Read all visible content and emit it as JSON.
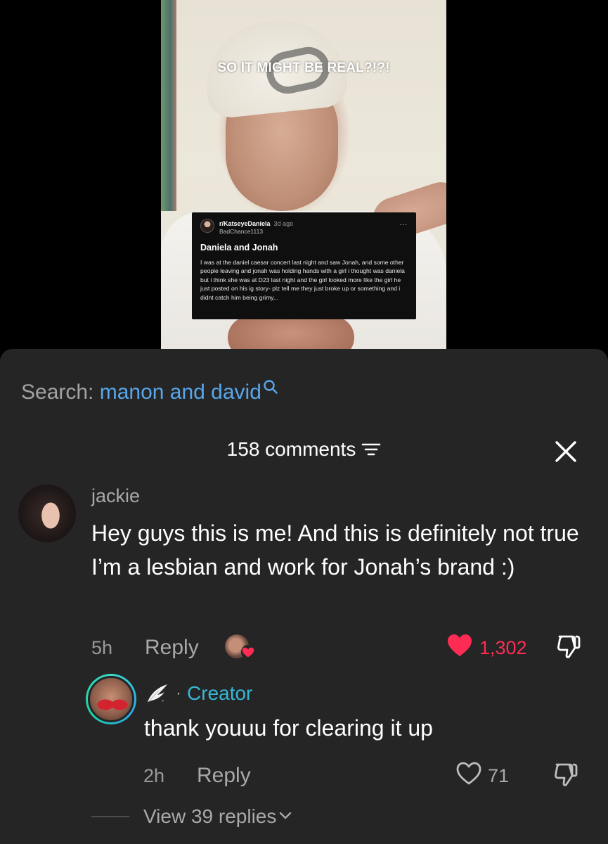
{
  "video": {
    "overlay_caption": "SO IT MIGHT BE REAL?!?!",
    "reddit_post": {
      "subreddit": "r/KatseyeDaniela",
      "age": "3d ago",
      "username": "BadChance1113",
      "more": "...",
      "title": "Daniela and Jonah",
      "body": "I was at the daniel caesar concert last night and saw Jonah, and some other people leaving and jonah was holding hands with a girl i thought was daniela but i think she was at D23 last night and the girl looked more like the girl he just posted on his ig story- plz tell me they just broke up or something and i didnt catch him being grimy..."
    }
  },
  "search": {
    "label": "Search:",
    "query": "manon and david"
  },
  "comments": {
    "count_label": "158 comments",
    "items": [
      {
        "author": "jackie",
        "text": "Hey guys this is me! And this is definitely not true I’m a lesbian and work for Jonah’s brand :)",
        "time": "5h",
        "reply_label": "Reply",
        "likes": "1,302",
        "liked": true,
        "replies": [
          {
            "author_badge": "Creator",
            "separator": "·",
            "text": "thank youuu for clearing it up",
            "time": "2h",
            "reply_label": "Reply",
            "likes": "71",
            "liked": false
          }
        ],
        "view_replies": "View 39 replies"
      }
    ]
  },
  "colors": {
    "sheet_bg": "#252525",
    "search_query": "#58a7ec",
    "like_red": "#fe2c55",
    "creator_badge": "#37b7d6"
  },
  "icons": [
    "search-icon",
    "sort-icon",
    "close-icon",
    "heart-icon",
    "heart-outline-icon",
    "dislike-icon",
    "wing-icon",
    "chevron-down-icon"
  ]
}
